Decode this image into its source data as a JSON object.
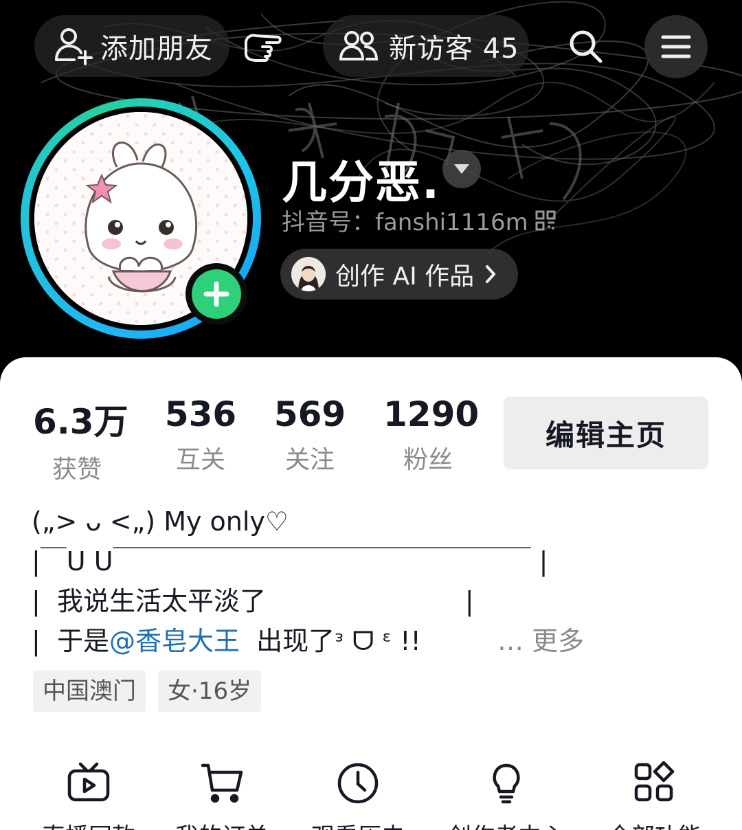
{
  "topbar": {
    "add_friend_label": "添加朋友",
    "visitors_label": "新访客 45",
    "icons": [
      "add-user-icon",
      "hand-pointer-icon",
      "visitors-icon",
      "search-icon",
      "menu-icon"
    ]
  },
  "profile": {
    "nickname": "几分恶.",
    "douyin_id": "抖音号：fanshi1116m",
    "ai_works_label": "创作 AI 作品",
    "ring_colors": [
      "#1fb8f5",
      "#26d0a0"
    ],
    "plus_color": "#2fd07a"
  },
  "stats": [
    {
      "value": "6.3万",
      "label": "获赞"
    },
    {
      "value": "536",
      "label": "互关"
    },
    {
      "value": "569",
      "label": "关注"
    },
    {
      "value": "1290",
      "label": "粉丝"
    }
  ],
  "edit_button_label": "编辑主页",
  "bio": {
    "line1": "(„> ᴗ <„) My only♡",
    "line2": "|￣U U￣￣￣￣￣￣￣￣￣￣￣￣￣￣￣￣ |",
    "line3": "|  我说生活太平淡了                        |",
    "line4_prefix": "|  于是",
    "line4_mention": "@香皂大王",
    "line4_suffix": "  出现了ᵌ ᗜ ᵋ !!",
    "more_label": "… 更多",
    "mention_color": "#1f6fb2"
  },
  "tags": [
    "中国澳门",
    "女·16岁"
  ],
  "tools": [
    {
      "label": "直播同款",
      "icon": "tv-play-icon"
    },
    {
      "label": "我的订单",
      "icon": "cart-icon"
    },
    {
      "label": "观看历史",
      "icon": "clock-icon"
    },
    {
      "label": "创作者中心",
      "icon": "lightbulb-icon"
    },
    {
      "label": "全部功能",
      "icon": "apps-grid-icon"
    }
  ]
}
